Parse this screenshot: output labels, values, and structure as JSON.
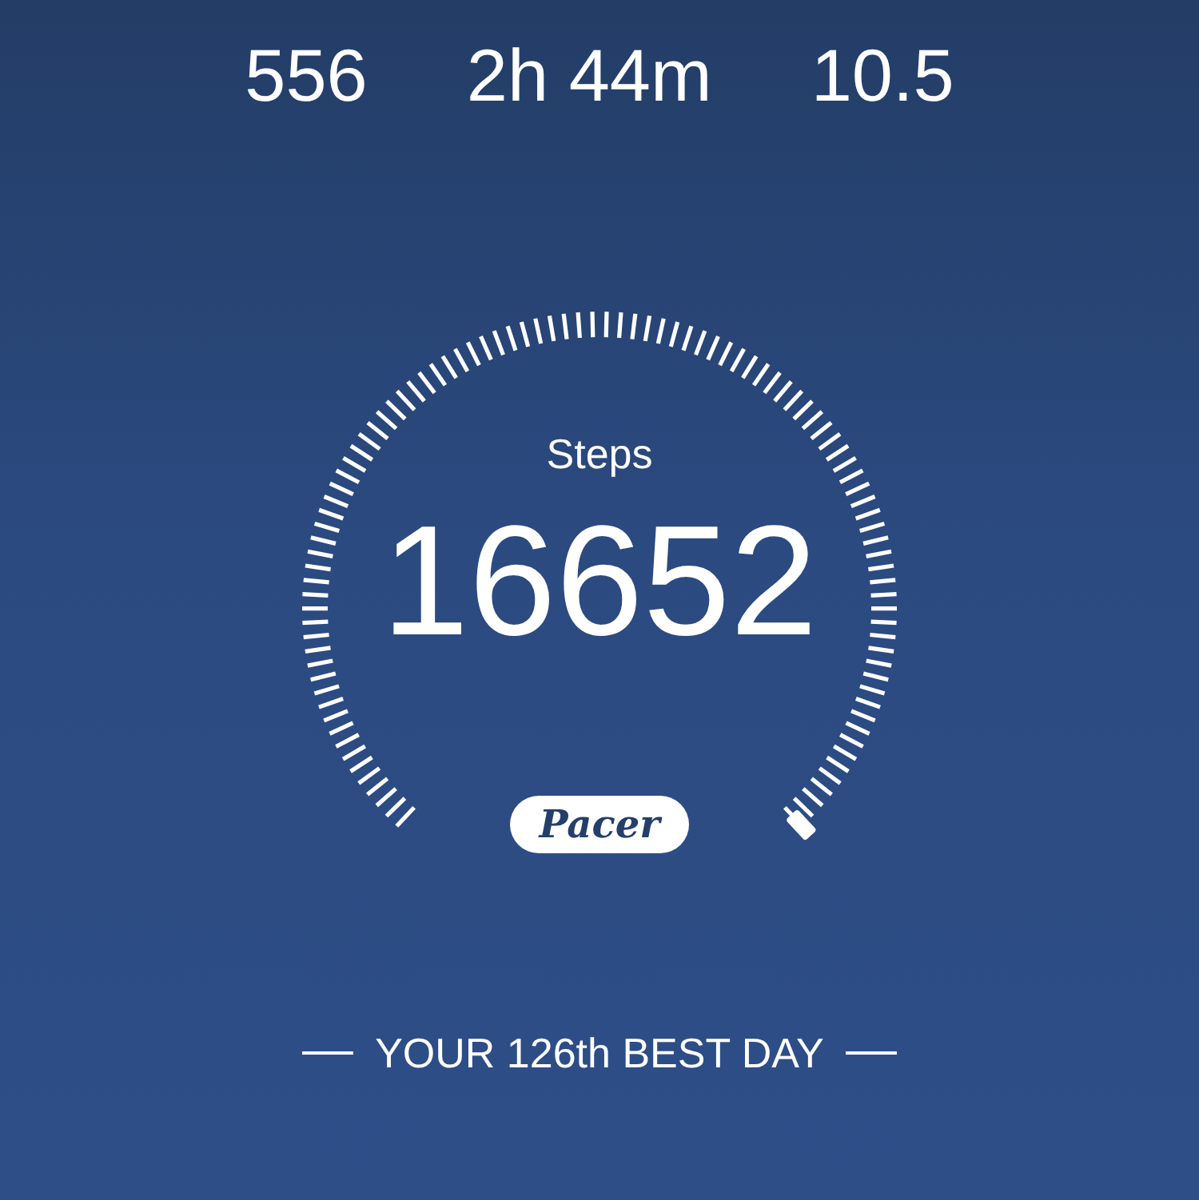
{
  "stats": [
    {
      "value": "556"
    },
    {
      "value": "2h 44m"
    },
    {
      "value": "10.5"
    }
  ],
  "gauge": {
    "label": "Steps",
    "value": "16652"
  },
  "badge": {
    "text": "Pacer"
  },
  "rank": {
    "text": "YOUR 126th BEST DAY"
  }
}
